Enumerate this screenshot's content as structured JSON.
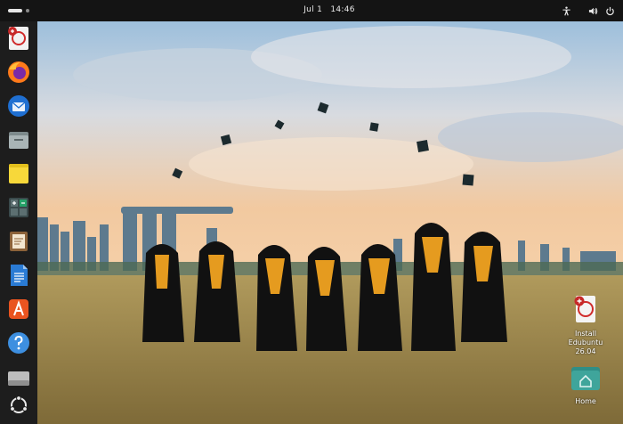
{
  "topbar": {
    "date": "Jul 1",
    "time": "14:46",
    "icons": [
      "accessibility-icon",
      "volume-icon",
      "power-icon"
    ]
  },
  "dock": {
    "items": [
      {
        "name": "edubuntu-installer",
        "icon": "edubuntu-installer-icon"
      },
      {
        "name": "firefox",
        "icon": "firefox-icon"
      },
      {
        "name": "thunderbird",
        "icon": "thunderbird-icon"
      },
      {
        "name": "files",
        "icon": "files-icon"
      },
      {
        "name": "notes",
        "icon": "notes-icon"
      },
      {
        "name": "calculator",
        "icon": "calculator-icon"
      },
      {
        "name": "editor",
        "icon": "text-editor-icon"
      },
      {
        "name": "writer",
        "icon": "writer-icon"
      },
      {
        "name": "app-center",
        "icon": "app-center-icon"
      },
      {
        "name": "help",
        "icon": "help-icon"
      },
      {
        "name": "removable-drive",
        "icon": "drive-icon"
      },
      {
        "name": "show-apps",
        "icon": "ubuntu-logo-icon"
      }
    ]
  },
  "desktop": {
    "icons": [
      {
        "label": "Install Edubuntu\n26.04",
        "line1": "Install Edubuntu",
        "line2": "26.04",
        "icon": "edubuntu-installer-icon"
      },
      {
        "label": "Home",
        "line1": "Home",
        "icon": "home-folder-icon"
      }
    ]
  },
  "colors": {
    "topbar": "#141414",
    "dock": "#1d1d1d",
    "accent": "#e95420",
    "sky_top": "#8fb8d8",
    "field": "#a08a4e"
  }
}
